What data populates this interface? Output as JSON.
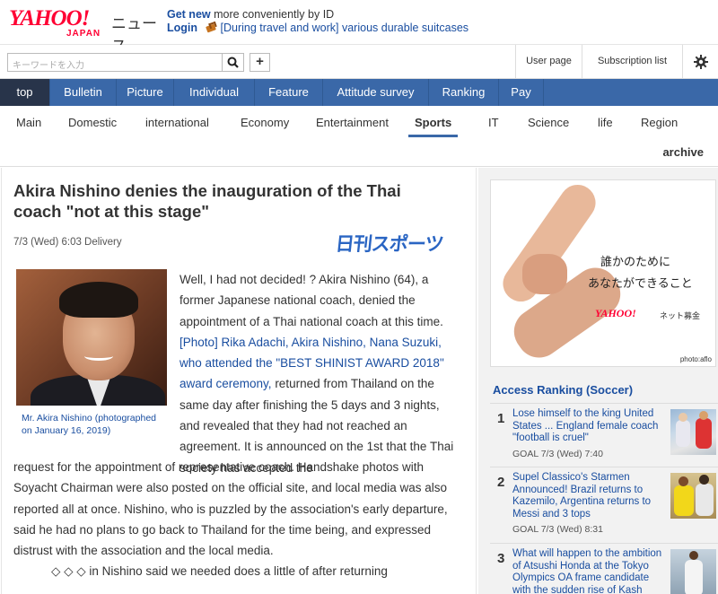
{
  "header": {
    "logo_text": "YAHOO!",
    "logo_sub": "JAPAN",
    "news_label": "ニュース",
    "promo_get_new": "Get new",
    "promo_rest": "more conveniently by ID",
    "promo_login": "Login",
    "promo_link": "[During travel and work] various durable suitcases"
  },
  "search": {
    "placeholder": "キーワードを入力",
    "plus_label": "+",
    "user_page": "User page",
    "subscription_list": "Subscription list"
  },
  "main_nav": [
    {
      "label": "top",
      "active": true,
      "width": 56
    },
    {
      "label": "Bulletin",
      "active": false,
      "width": 74
    },
    {
      "label": "Picture",
      "active": false,
      "width": 64
    },
    {
      "label": "Individual",
      "active": false,
      "width": 90
    },
    {
      "label": "Feature",
      "active": false,
      "width": 76
    },
    {
      "label": "Attitude survey",
      "active": false,
      "width": 118
    },
    {
      "label": "Ranking",
      "active": false,
      "width": 78
    },
    {
      "label": "Pay",
      "active": false,
      "width": 50
    }
  ],
  "sub_nav": {
    "items": [
      "Main",
      "Domestic",
      "international",
      "Economy",
      "Entertainment",
      "Sports",
      "IT",
      "Science",
      "life",
      "Region"
    ],
    "active": "Sports",
    "archive": "archive"
  },
  "article": {
    "headline": "Akira Nishino denies the inauguration of the Thai coach \"not at this stage\"",
    "delivery": "7/3 (Wed) 6:03 Delivery",
    "source": "日刊スポーツ",
    "photo_caption": "Mr. Akira Nishino (photographed on January 16, 2019)",
    "para_part1": "Well, I had not decided! ? Akira Nishino (64), a former Japanese national coach, denied the appointment of a Thai national coach at this time.",
    "para_link": "[Photo] Rika Adachi, Akira Nishino, Nana Suzuki, who attended the \"BEST SHINIST AWARD 2018\" award ceremony,",
    "para_part2": "returned from Thailand on the same day after finishing the 5 days and 3 nights, and revealed that they had not reached an agreement. It is announced on the 1st that the Thai society has accepted the",
    "para_full": "request for the appointment of representative coach. Handshake photos with Soyacht Chairman were also posted on the official site, and local media was also reported all at once. Nishino, who is puzzled by the association's early departure, said he had no plans to go back to Thailand for the time being, and expressed distrust with the association and the local media.",
    "para_cutoff": "◇ ◇ ◇ in Nishino said we needed does a little of after returning"
  },
  "ad": {
    "line1": "誰かのために",
    "line2": "あなたができること",
    "logo": "YAHOO!",
    "logo_sub": "ネット募金",
    "credit": "photo:aflo"
  },
  "ranking": {
    "title": "Access Ranking (Soccer)",
    "items": [
      {
        "rank": "1",
        "title": "Lose himself to the king United States ... England female coach \"football is cruel\"",
        "meta": "GOAL 7/3 (Wed) 7:40"
      },
      {
        "rank": "2",
        "title": "Supel Classico's Starmen Announced! Brazil returns to Kazemilo, Argentina returns to Messi and 3 tops",
        "meta": "GOAL 7/3 (Wed) 8:31"
      },
      {
        "rank": "3",
        "title": "What will happen to the ambition of Atsushi Honda at the Tokyo Olympics OA frame candidate with the sudden rise of Kash",
        "meta": ""
      }
    ]
  }
}
